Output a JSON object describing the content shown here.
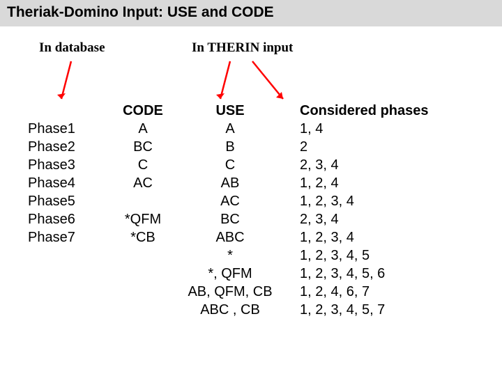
{
  "title": "Theriak-Domino Input: USE and CODE",
  "headers": {
    "database": "In database",
    "therin": "In THERIN input"
  },
  "columns": {
    "code_label": "CODE",
    "use_label": "USE",
    "considered_label": "Considered phases"
  },
  "phase_rows": [
    "Phase1",
    "Phase2",
    "Phase3",
    "Phase4",
    "Phase5",
    "Phase6",
    "Phase7"
  ],
  "code_rows": [
    "A",
    "BC",
    "C",
    "AC",
    "",
    "*QFM",
    "*CB"
  ],
  "use_rows": [
    "A",
    "B",
    "C",
    "AB",
    "AC",
    "BC",
    "ABC",
    "*",
    "*, QFM",
    "AB, QFM, CB",
    "ABC , CB"
  ],
  "considered_rows": [
    "1, 4",
    "2",
    "2, 3, 4",
    "1, 2, 4",
    "1, 2, 3, 4",
    "2, 3, 4",
    "1, 2, 3, 4",
    "1, 2, 3, 4, 5",
    "1, 2, 3, 4, 5, 6",
    "1, 2, 4, 6, 7",
    "1, 2, 3, 4, 5, 7"
  ]
}
